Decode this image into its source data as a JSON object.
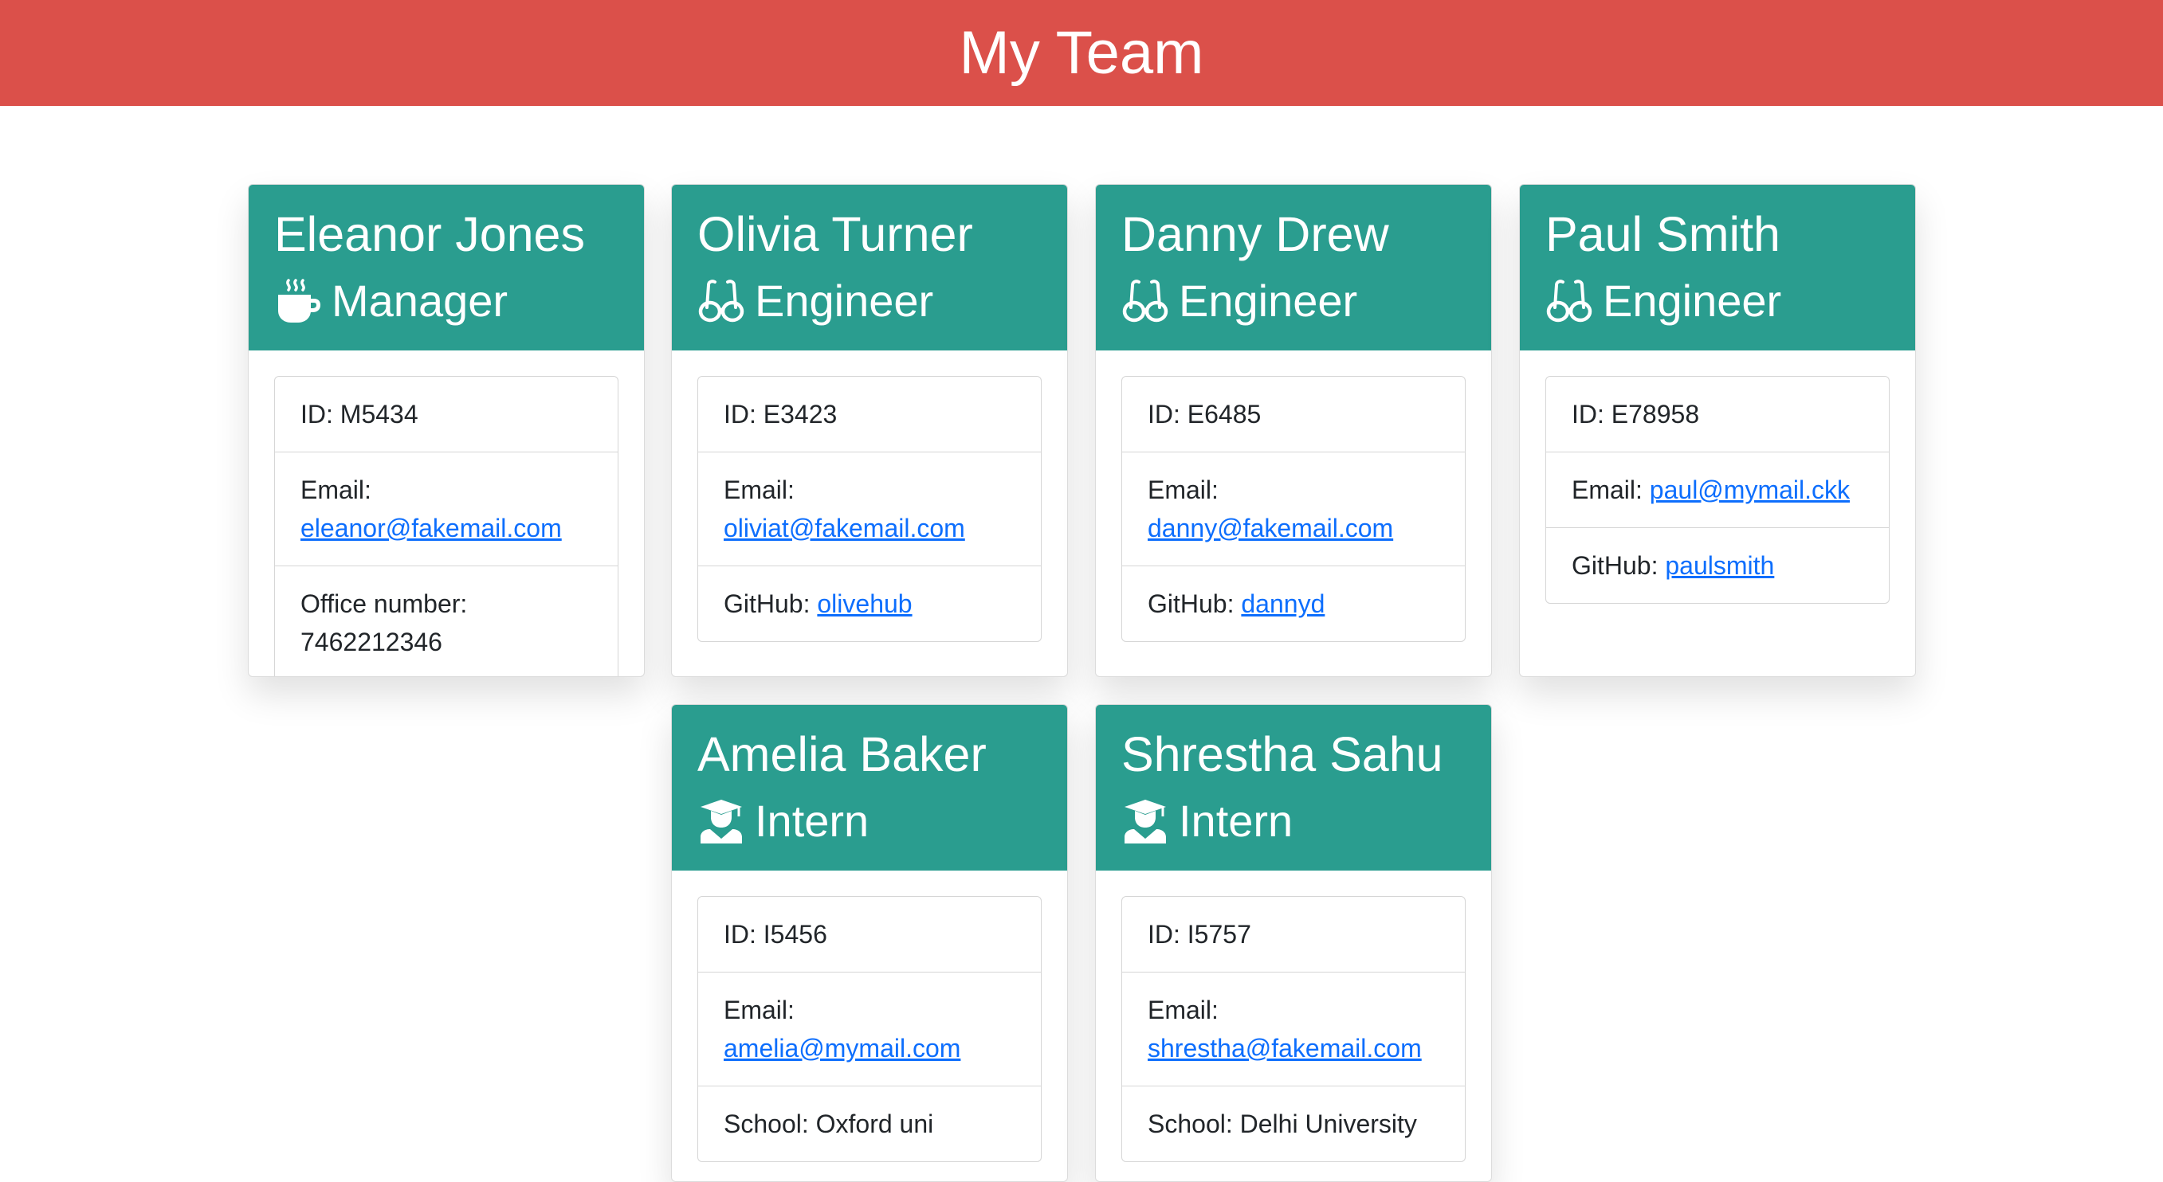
{
  "page": {
    "title": "My Team",
    "header_color": "#db504a",
    "card_header_color": "#2a9d8f",
    "link_color": "#0d6efd"
  },
  "members": [
    {
      "name": "Eleanor Jones",
      "role": "Manager",
      "icon": "coffee-mug-icon",
      "id_label": "ID: M5434",
      "email_label": "Email:",
      "email": "eleanor@fakemail.com",
      "extra_label": "Office number:",
      "extra_value": "7462212346"
    },
    {
      "name": "Olivia Turner",
      "role": "Engineer",
      "icon": "glasses-icon",
      "id_label": "ID: E3423",
      "email_label": "Email:",
      "email": "oliviat@fakemail.com",
      "extra_label": "GitHub:",
      "extra_value": "olivehub"
    },
    {
      "name": "Danny Drew",
      "role": "Engineer",
      "icon": "glasses-icon",
      "id_label": "ID: E6485",
      "email_label": "Email:",
      "email": "danny@fakemail.com",
      "extra_label": "GitHub:",
      "extra_value": "dannyd"
    },
    {
      "name": "Paul Smith",
      "role": "Engineer",
      "icon": "glasses-icon",
      "id_label": "ID: E78958",
      "email_label": "Email:",
      "email": "paul@mymail.ckk",
      "extra_label": "GitHub:",
      "extra_value": "paulsmith"
    },
    {
      "name": "Amelia Baker",
      "role": "Intern",
      "icon": "graduate-icon",
      "id_label": "ID: I5456",
      "email_label": "Email:",
      "email": "amelia@mymail.com",
      "extra_label": "School:",
      "extra_value": "Oxford uni"
    },
    {
      "name": "Shrestha Sahu",
      "role": "Intern",
      "icon": "graduate-icon",
      "id_label": "ID: I5757",
      "email_label": "Email:",
      "email": "shrestha@fakemail.com",
      "extra_label": "School:",
      "extra_value": "Delhi University"
    }
  ]
}
